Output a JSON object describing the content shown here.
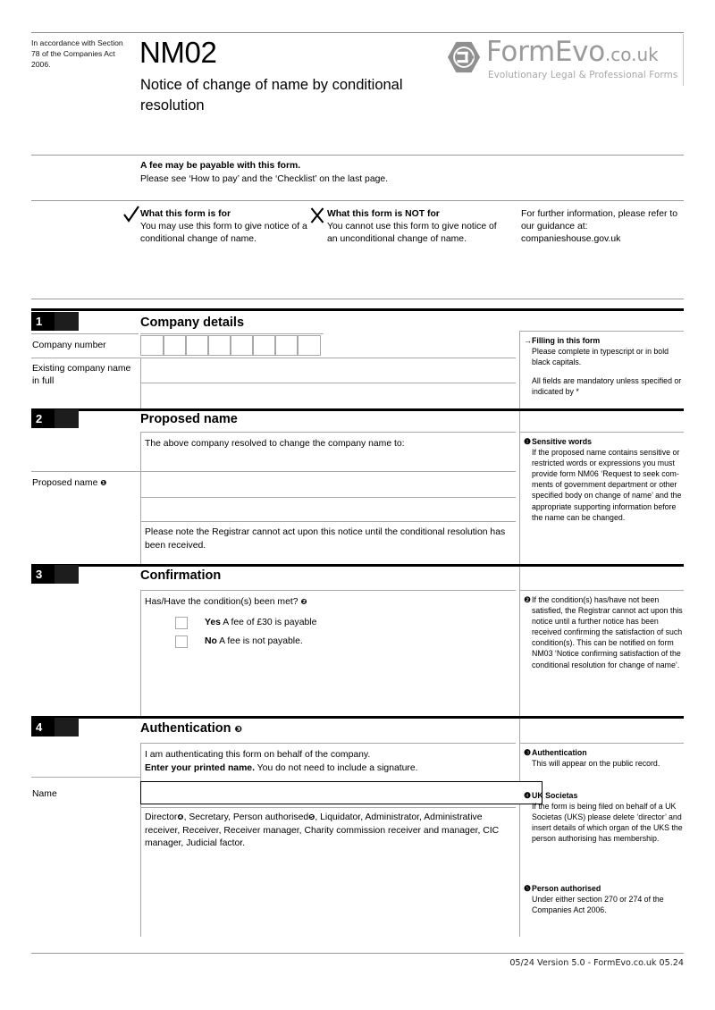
{
  "header": {
    "accordance": "In accordance with Section 78 of the Companies Act 2006.",
    "form_code": "NM02",
    "form_title": "Notice of change of name by conditional resolution",
    "logo_name": "FormEvo",
    "logo_tld": ".co.uk",
    "logo_tagline": "Evolutionary Legal & Professional Forms"
  },
  "fee": {
    "line1": "A fee may be payable with this form.",
    "line2": "Please see ‘How to pay’ and the ‘Checklist’ on the last page."
  },
  "usage": {
    "for_heading": "What this form is for",
    "for_body": "You may use this form to give notice of a conditional change of name.",
    "notfor_heading": "What this form is NOT for",
    "notfor_body": "You cannot use this form to give notice of an unconditional change of name.",
    "further_info": "For further information, please refer to our guidance at: companieshouse.gov.uk"
  },
  "sections": [
    {
      "number": "1",
      "title": "Company details",
      "labels": {
        "company_number": "Company number",
        "existing_name": "Existing company name in full"
      },
      "company_number_boxes": 8
    },
    {
      "number": "2",
      "title": "Proposed name",
      "intro": "The above company resolved to change the company name to:",
      "label": "Proposed name",
      "label_marker": "❶",
      "note": "Please note the Registrar cannot act upon this notice until the conditional resolution has been received."
    },
    {
      "number": "3",
      "title": "Confirmation",
      "question": "Has/Have the condition(s) been met?",
      "question_marker": "❷",
      "options": [
        {
          "bold": "Yes",
          "rest": " A fee of £30 is payable"
        },
        {
          "bold": "No",
          "rest": " A fee is not payable."
        }
      ]
    },
    {
      "number": "4",
      "title": "Authentication",
      "title_marker": "❸",
      "statement_line1": "I am authenticating this form on behalf of the company.",
      "statement_bold": "Enter your printed name.",
      "statement_rest": " You do not need to include a signature.",
      "name_label": "Name",
      "name_value": "",
      "roles_part1": "Director",
      "roles_marker1": "❹",
      "roles_part2": ", Secretary, Person authorised",
      "roles_marker2": "❺",
      "roles_part3": ", Liquidator, Administrator, Administrative receiver, Receiver, Receiver manager, Charity commission receiver and manager, CIC manager, Judicial factor."
    }
  ],
  "guidance": [
    {
      "marker": "→",
      "heading": "Filling in this form",
      "paragraphs": [
        "Please complete in typescript or in bold black capitals.",
        "All fields are mandatory unless specified or indicated by *"
      ]
    },
    {
      "marker": "❶",
      "heading": "Sensitive words",
      "paragraphs": [
        "If the proposed name contains sensitive or restricted words or expressions you must provide form NM06 ‘Request to seek com-ments of government department or other specified body on change of name’ and the appropriate supporting information before the name can be changed."
      ]
    },
    {
      "marker": "❷",
      "heading": "",
      "paragraphs": [
        "If the condition(s) has/have not been satisfied, the Registrar cannot act upon this notice until a further notice has been received confirming the satisfaction of such condition(s). This can be notified on form NM03 ‘Notice confirming satisfaction of the conditional resolution for change of name’."
      ]
    },
    {
      "marker": "❸",
      "heading": "Authentication",
      "paragraphs": [
        "This will appear on the public record."
      ]
    },
    {
      "marker": "❹",
      "heading": "UK Societas",
      "paragraphs": [
        "If the form is being filed on behalf of a UK Societas (UKS) please delete ‘director’ and insert details of which organ of the UKS the person authorising has membership."
      ]
    },
    {
      "marker": "❺",
      "heading": "Person authorised",
      "paragraphs": [
        "Under either section 270 or 274 of the Companies Act 2006."
      ]
    }
  ],
  "footer": {
    "text": "05/24 Version 5.0 - FormEvo.co.uk 05.24"
  }
}
